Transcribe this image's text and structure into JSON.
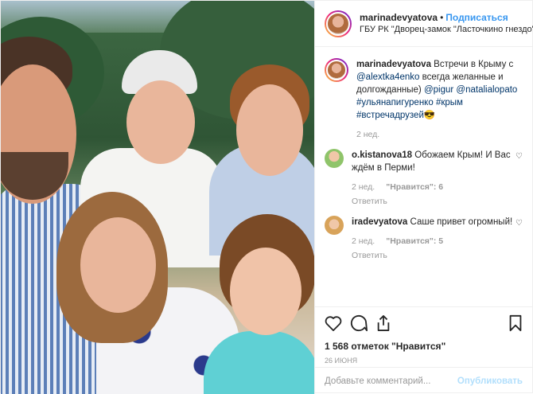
{
  "header": {
    "username": "marinadevyatova",
    "dot": "•",
    "follow_label": "Подписаться",
    "location": "ГБУ РК \"Дворец-замок \"Ласточкино гнездо\"\""
  },
  "caption": {
    "username": "marinadevyatova",
    "text_1": " Встречи в Крыму с ",
    "mention_1": "@alextka4enko",
    "text_2": " всегда желанные и долгожданные) ",
    "mention_2": "@pigur",
    "mention_3": "@natalialopato",
    "tag_1": "#ульянапигуренко",
    "tag_2": "#крым",
    "tag_3": "#встречадрузей",
    "emoji": "😎",
    "time": "2 нед."
  },
  "comments": [
    {
      "username": "o.kistanova18",
      "text": " Обожаем Крым! И Вас ждём в Перми!",
      "time": "2 нед.",
      "likes": "\"Нравится\": 6",
      "reply": "Ответить"
    },
    {
      "username": "iradevyatova",
      "text": " Саше привет огромный!",
      "time": "2 нед.",
      "likes": "\"Нравится\": 5",
      "reply": "Ответить"
    }
  ],
  "footer": {
    "likes_count": "1 568",
    "likes_word": " отметок \"Нравится\"",
    "date": "26 июня",
    "add_comment_placeholder": "Добавьте комментарий...",
    "publish_label": "Опубликовать"
  },
  "colors": {
    "accent": "#3897f0",
    "link": "#003569",
    "muted": "#999999"
  }
}
